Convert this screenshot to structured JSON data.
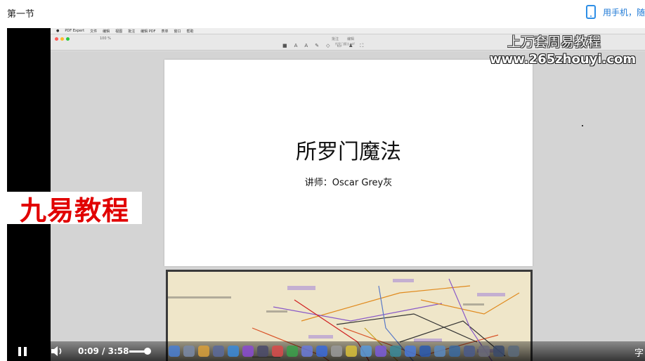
{
  "header": {
    "section_title": "第一节",
    "mobile_link": "用手机，随"
  },
  "app": {
    "name": "PDF Expert",
    "menu_items": [
      "文件",
      "编辑",
      "视图",
      "批注",
      "编辑 PDF",
      "表单",
      "窗口",
      "帮助"
    ],
    "zoom": "100 %",
    "tabs": [
      "批注",
      "编辑"
    ],
    "file_name": "所罗门魔法.pdf"
  },
  "slide": {
    "title": "所罗门魔法",
    "subtitle": "讲师：Oscar Grey灰"
  },
  "watermarks": {
    "line1": "上万套周易教程",
    "line2": "www.265zhouyi.com"
  },
  "brand": {
    "label": "九易教程"
  },
  "player": {
    "current_time": "0:09",
    "separator": "/",
    "duration": "3:58",
    "volume_level": 0.88,
    "subtitle_button": "字"
  },
  "colors": {
    "link": "#1f7ad6",
    "brand_red": "#e10000"
  }
}
